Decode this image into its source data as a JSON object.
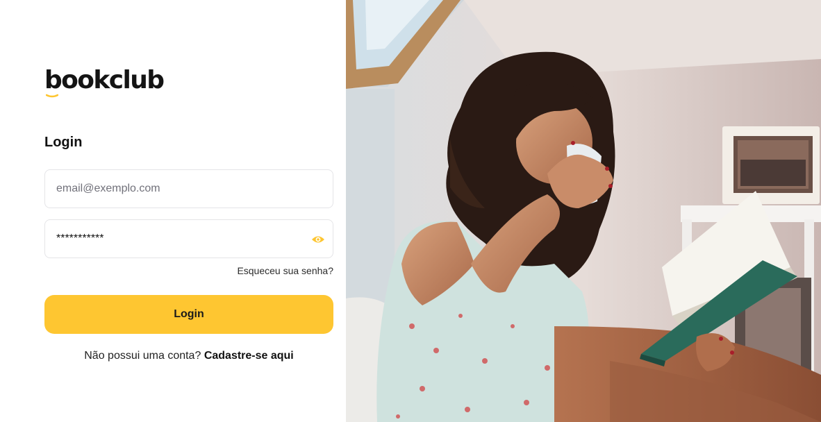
{
  "brand": {
    "name": "bookclub",
    "accent_color": "#fec631"
  },
  "login": {
    "heading": "Login",
    "email_placeholder": "email@exemplo.com",
    "password_value": "***********",
    "password_toggle_icon": "eye-icon",
    "forgot_password": "Esqueceu sua senha?",
    "submit_label": "Login",
    "signup_prompt": "Não possui uma conta?",
    "signup_link": "Cadastre-se aqui"
  },
  "hero": {
    "image": "woman-drinking-coffee-reading-book-photo"
  }
}
